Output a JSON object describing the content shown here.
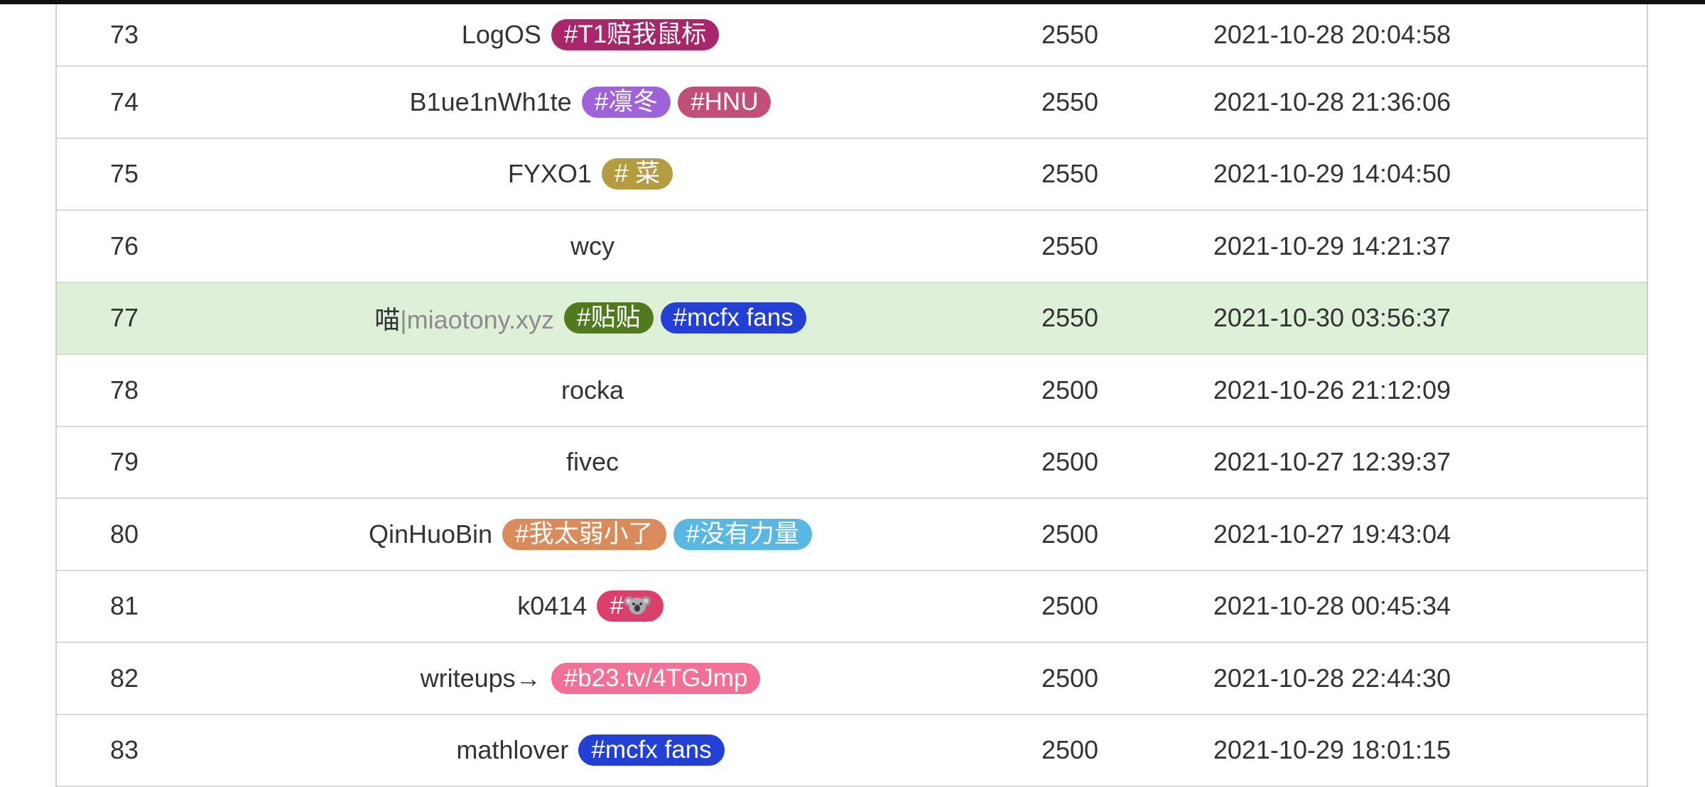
{
  "rows": [
    {
      "rank": "73",
      "name": "LogOS",
      "name_suffix": "",
      "tags": [
        {
          "text": "#T1赔我鼠标",
          "color": "#a8276a"
        }
      ],
      "score": "2550",
      "time": "2021-10-28 20:04:58",
      "highlight": false
    },
    {
      "rank": "74",
      "name": "B1ue1nWh1te",
      "name_suffix": "",
      "tags": [
        {
          "text": "#凛冬",
          "color": "#9e62da"
        },
        {
          "text": "#HNU",
          "color": "#c24f78"
        }
      ],
      "score": "2550",
      "time": "2021-10-28 21:36:06",
      "highlight": false
    },
    {
      "rank": "75",
      "name": "FYXO1",
      "name_suffix": "",
      "tags": [
        {
          "text": "# 菜",
          "color": "#b49c3f"
        }
      ],
      "score": "2550",
      "time": "2021-10-29 14:04:50",
      "highlight": false
    },
    {
      "rank": "76",
      "name": "wcy",
      "name_suffix": "",
      "tags": [],
      "score": "2550",
      "time": "2021-10-29 14:21:37",
      "highlight": false
    },
    {
      "rank": "77",
      "name": "喵",
      "name_suffix": "|miaotony.xyz",
      "tags": [
        {
          "text": "#贴贴",
          "color": "#4f7a1e"
        },
        {
          "text": "#mcfx fans",
          "color": "#2340d6"
        }
      ],
      "score": "2550",
      "time": "2021-10-30 03:56:37",
      "highlight": true
    },
    {
      "rank": "78",
      "name": "rocka",
      "name_suffix": "",
      "tags": [],
      "score": "2500",
      "time": "2021-10-26 21:12:09",
      "highlight": false
    },
    {
      "rank": "79",
      "name": "fivec",
      "name_suffix": "",
      "tags": [],
      "score": "2500",
      "time": "2021-10-27 12:39:37",
      "highlight": false
    },
    {
      "rank": "80",
      "name": "QinHuoBin",
      "name_suffix": "",
      "tags": [
        {
          "text": "#我太弱小了",
          "color": "#d98c59"
        },
        {
          "text": "#没有力量",
          "color": "#58b7e3"
        }
      ],
      "score": "2500",
      "time": "2021-10-27 19:43:04",
      "highlight": false
    },
    {
      "rank": "81",
      "name": "k0414",
      "name_suffix": "",
      "tags": [
        {
          "text": "#",
          "color": "#dd3f6c",
          "icon": "koala-icon"
        }
      ],
      "score": "2500",
      "time": "2021-10-28 00:45:34",
      "highlight": false
    },
    {
      "rank": "82",
      "name": "writeups→",
      "name_suffix": "",
      "tags": [
        {
          "text": "#b23.tv/4TGJmp",
          "color": "#f46f95"
        }
      ],
      "score": "2500",
      "time": "2021-10-28 22:44:30",
      "highlight": false
    },
    {
      "rank": "83",
      "name": "mathlover",
      "name_suffix": "",
      "tags": [
        {
          "text": "#mcfx fans",
          "color": "#2340d6"
        }
      ],
      "score": "2500",
      "time": "2021-10-29 18:01:15",
      "highlight": false
    }
  ]
}
